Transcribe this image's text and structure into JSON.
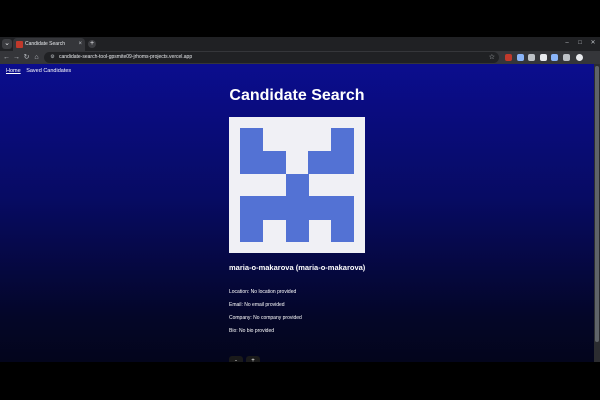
{
  "browser": {
    "tab_title": "Candidate Search",
    "tab_close": "×",
    "new_tab": "+",
    "url": "candidate-search-tool-gpsmite09-jrhoms-projects.vercel.app",
    "menu_icon": "chevron-down-icon",
    "window_controls": {
      "minimize": "–",
      "maximize": "□",
      "close": "✕"
    },
    "nav": {
      "back": "←",
      "forward": "→",
      "reload": "↻",
      "home": "⌂"
    },
    "star": "☆",
    "extension_colors": [
      "#c0392b",
      "#8ab4f8",
      "#bdc1c6",
      "#e8eaed",
      "#8ab4f8",
      "#bdc1c6",
      "#e8eaed"
    ]
  },
  "page": {
    "nav": {
      "home": "Home",
      "saved": "Saved Candidates"
    },
    "title": "Candidate Search",
    "avatar_colors": {
      "background": "#f0f0f5",
      "foreground": "#5372d4"
    },
    "candidate": {
      "name": "maria-o-makarova (maria-o-makarova)",
      "location": "Location: No location provided",
      "email": "Email: No email provided",
      "company": "Company: No company provided",
      "bio": "Bio: No bio provided"
    },
    "buttons": {
      "reject": "-",
      "accept": "+"
    }
  }
}
